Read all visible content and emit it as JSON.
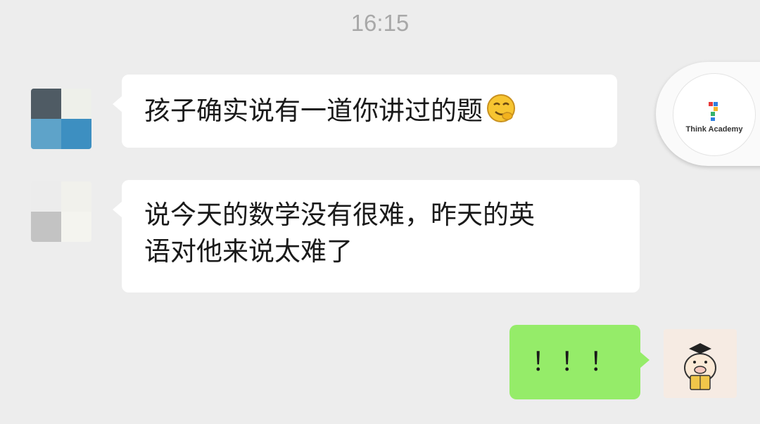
{
  "status": {
    "time": "16:15"
  },
  "messages": [
    {
      "side": "left",
      "text": "孩子确实说有一道你讲过的题",
      "emoji": "smirking-face-emoji"
    },
    {
      "side": "left",
      "text_line1": "说今天的数学没有很难，昨天的英",
      "text_line2": "语对他来说太难了"
    },
    {
      "side": "right",
      "text": "！！！"
    }
  ],
  "floating_widget": {
    "label": "Think Academy",
    "icon": "think-academy-logo"
  },
  "colors": {
    "background": "#ededed",
    "incoming_bubble": "#ffffff",
    "outgoing_bubble": "#95ec69",
    "timestamp": "#a8a8a8"
  }
}
